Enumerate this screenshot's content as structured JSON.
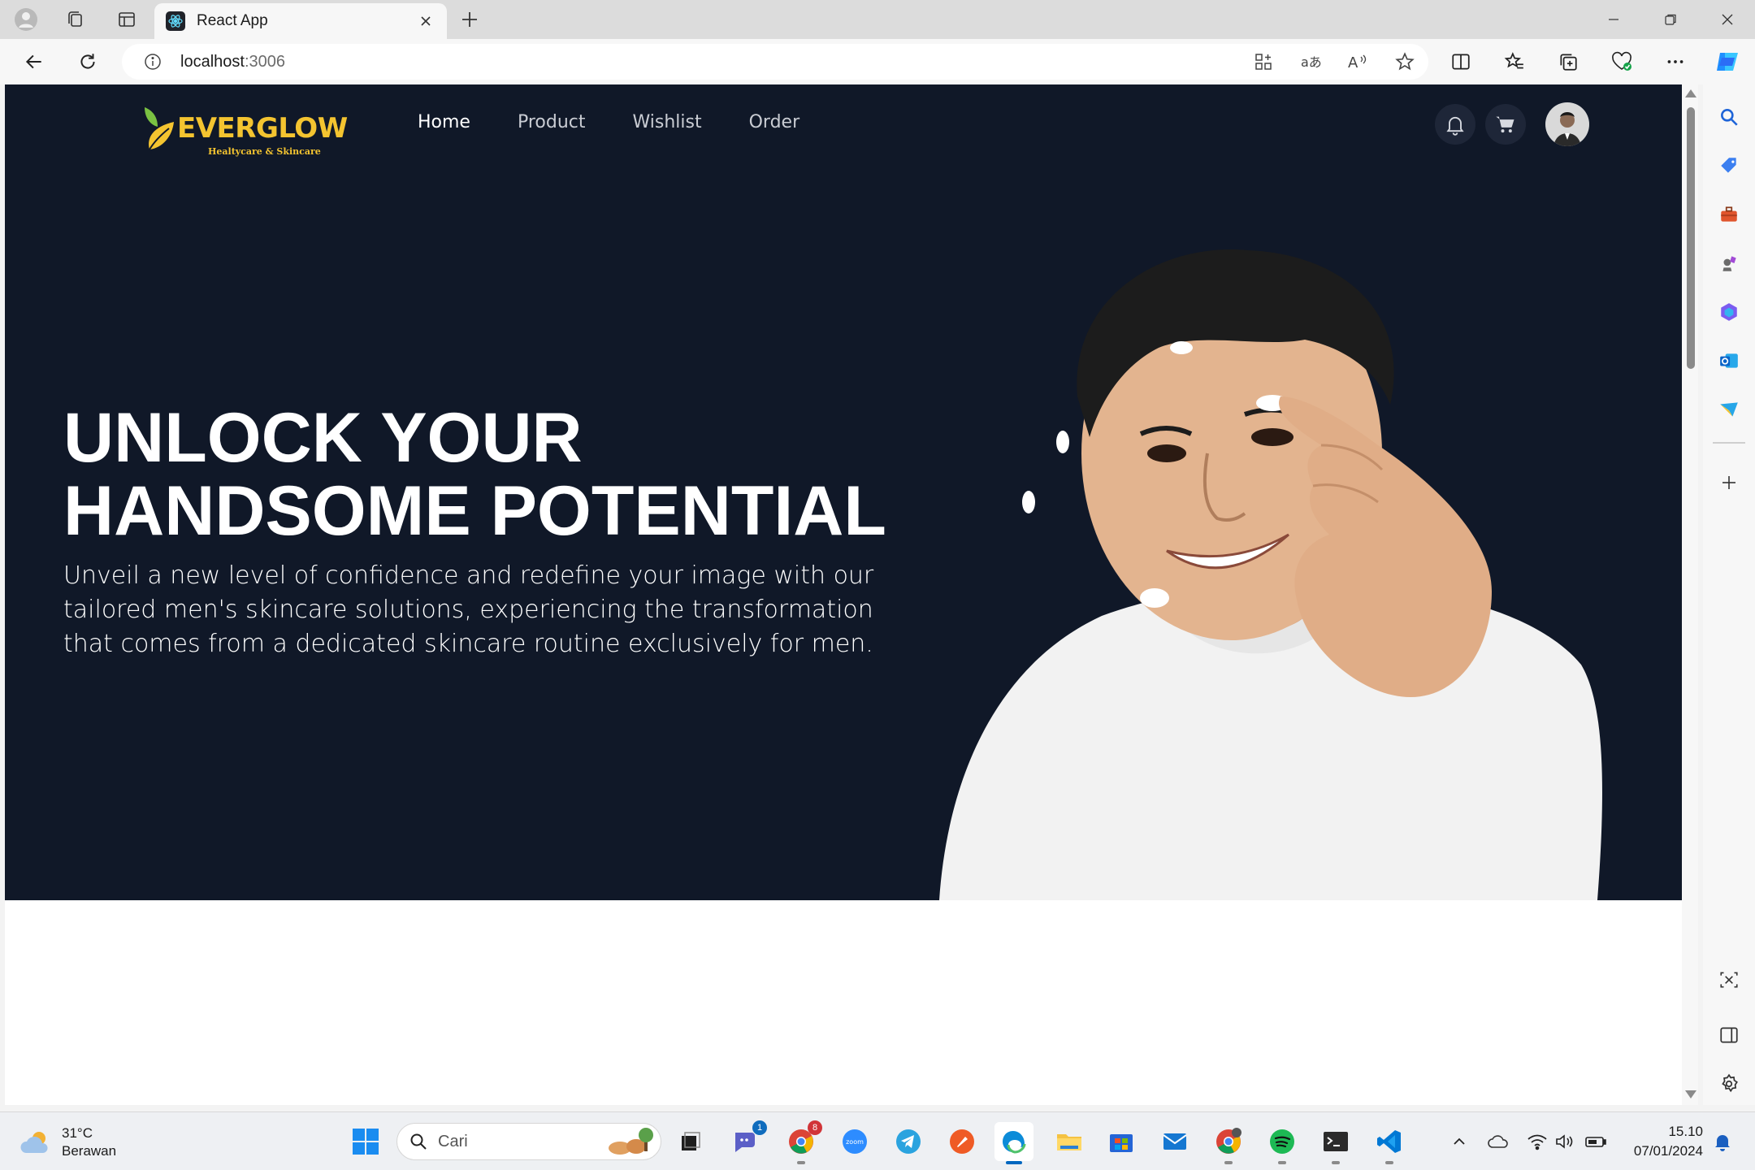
{
  "browser": {
    "tab_title": "React App",
    "url_host": "localhost",
    "url_port": ":3006"
  },
  "site": {
    "brand": "EVERGLOW",
    "tagline": "Healtycare & Skincare",
    "nav": [
      {
        "label": "Home",
        "active": true
      },
      {
        "label": "Product",
        "active": false
      },
      {
        "label": "Wishlist",
        "active": false
      },
      {
        "label": "Order",
        "active": false
      }
    ],
    "hero": {
      "headline_line1": "UNLOCK YOUR",
      "headline_line2": "HANDSOME POTENTIAL",
      "description": "Unveil a new level of confidence and redefine your image with our tailored men's skincare solutions, experiencing the transformation that comes from a dedicated skincare routine exclusively for men."
    },
    "colors": {
      "hero_bg": "#101828",
      "brand_yellow": "#f4c430",
      "brand_green": "#7ac142"
    }
  },
  "taskbar": {
    "weather_temp": "31°C",
    "weather_desc": "Berawan",
    "search_placeholder": "Cari",
    "teams_badge": "1",
    "chrome_badge": "8",
    "time": "15.10",
    "date": "07/01/2024"
  },
  "icons": {
    "titlebar": [
      "profile-icon",
      "collections-icon",
      "tab-actions-icon"
    ],
    "toolbar": [
      "back-icon",
      "refresh-icon",
      "info-icon",
      "app-available-icon",
      "translate-icon",
      "read-aloud-icon",
      "favorite-star-icon",
      "split-screen-icon",
      "favorites-icon",
      "collections-icon",
      "browser-essentials-icon",
      "more-icon",
      "copilot-icon"
    ],
    "sidebar": [
      "search-icon",
      "shopping-tag-icon",
      "tools-icon",
      "games-icon",
      "microsoft365-icon",
      "outlook-icon",
      "send-icon",
      "add-icon",
      "screenshot-icon",
      "sidebar-toggle-icon",
      "settings-icon"
    ]
  }
}
